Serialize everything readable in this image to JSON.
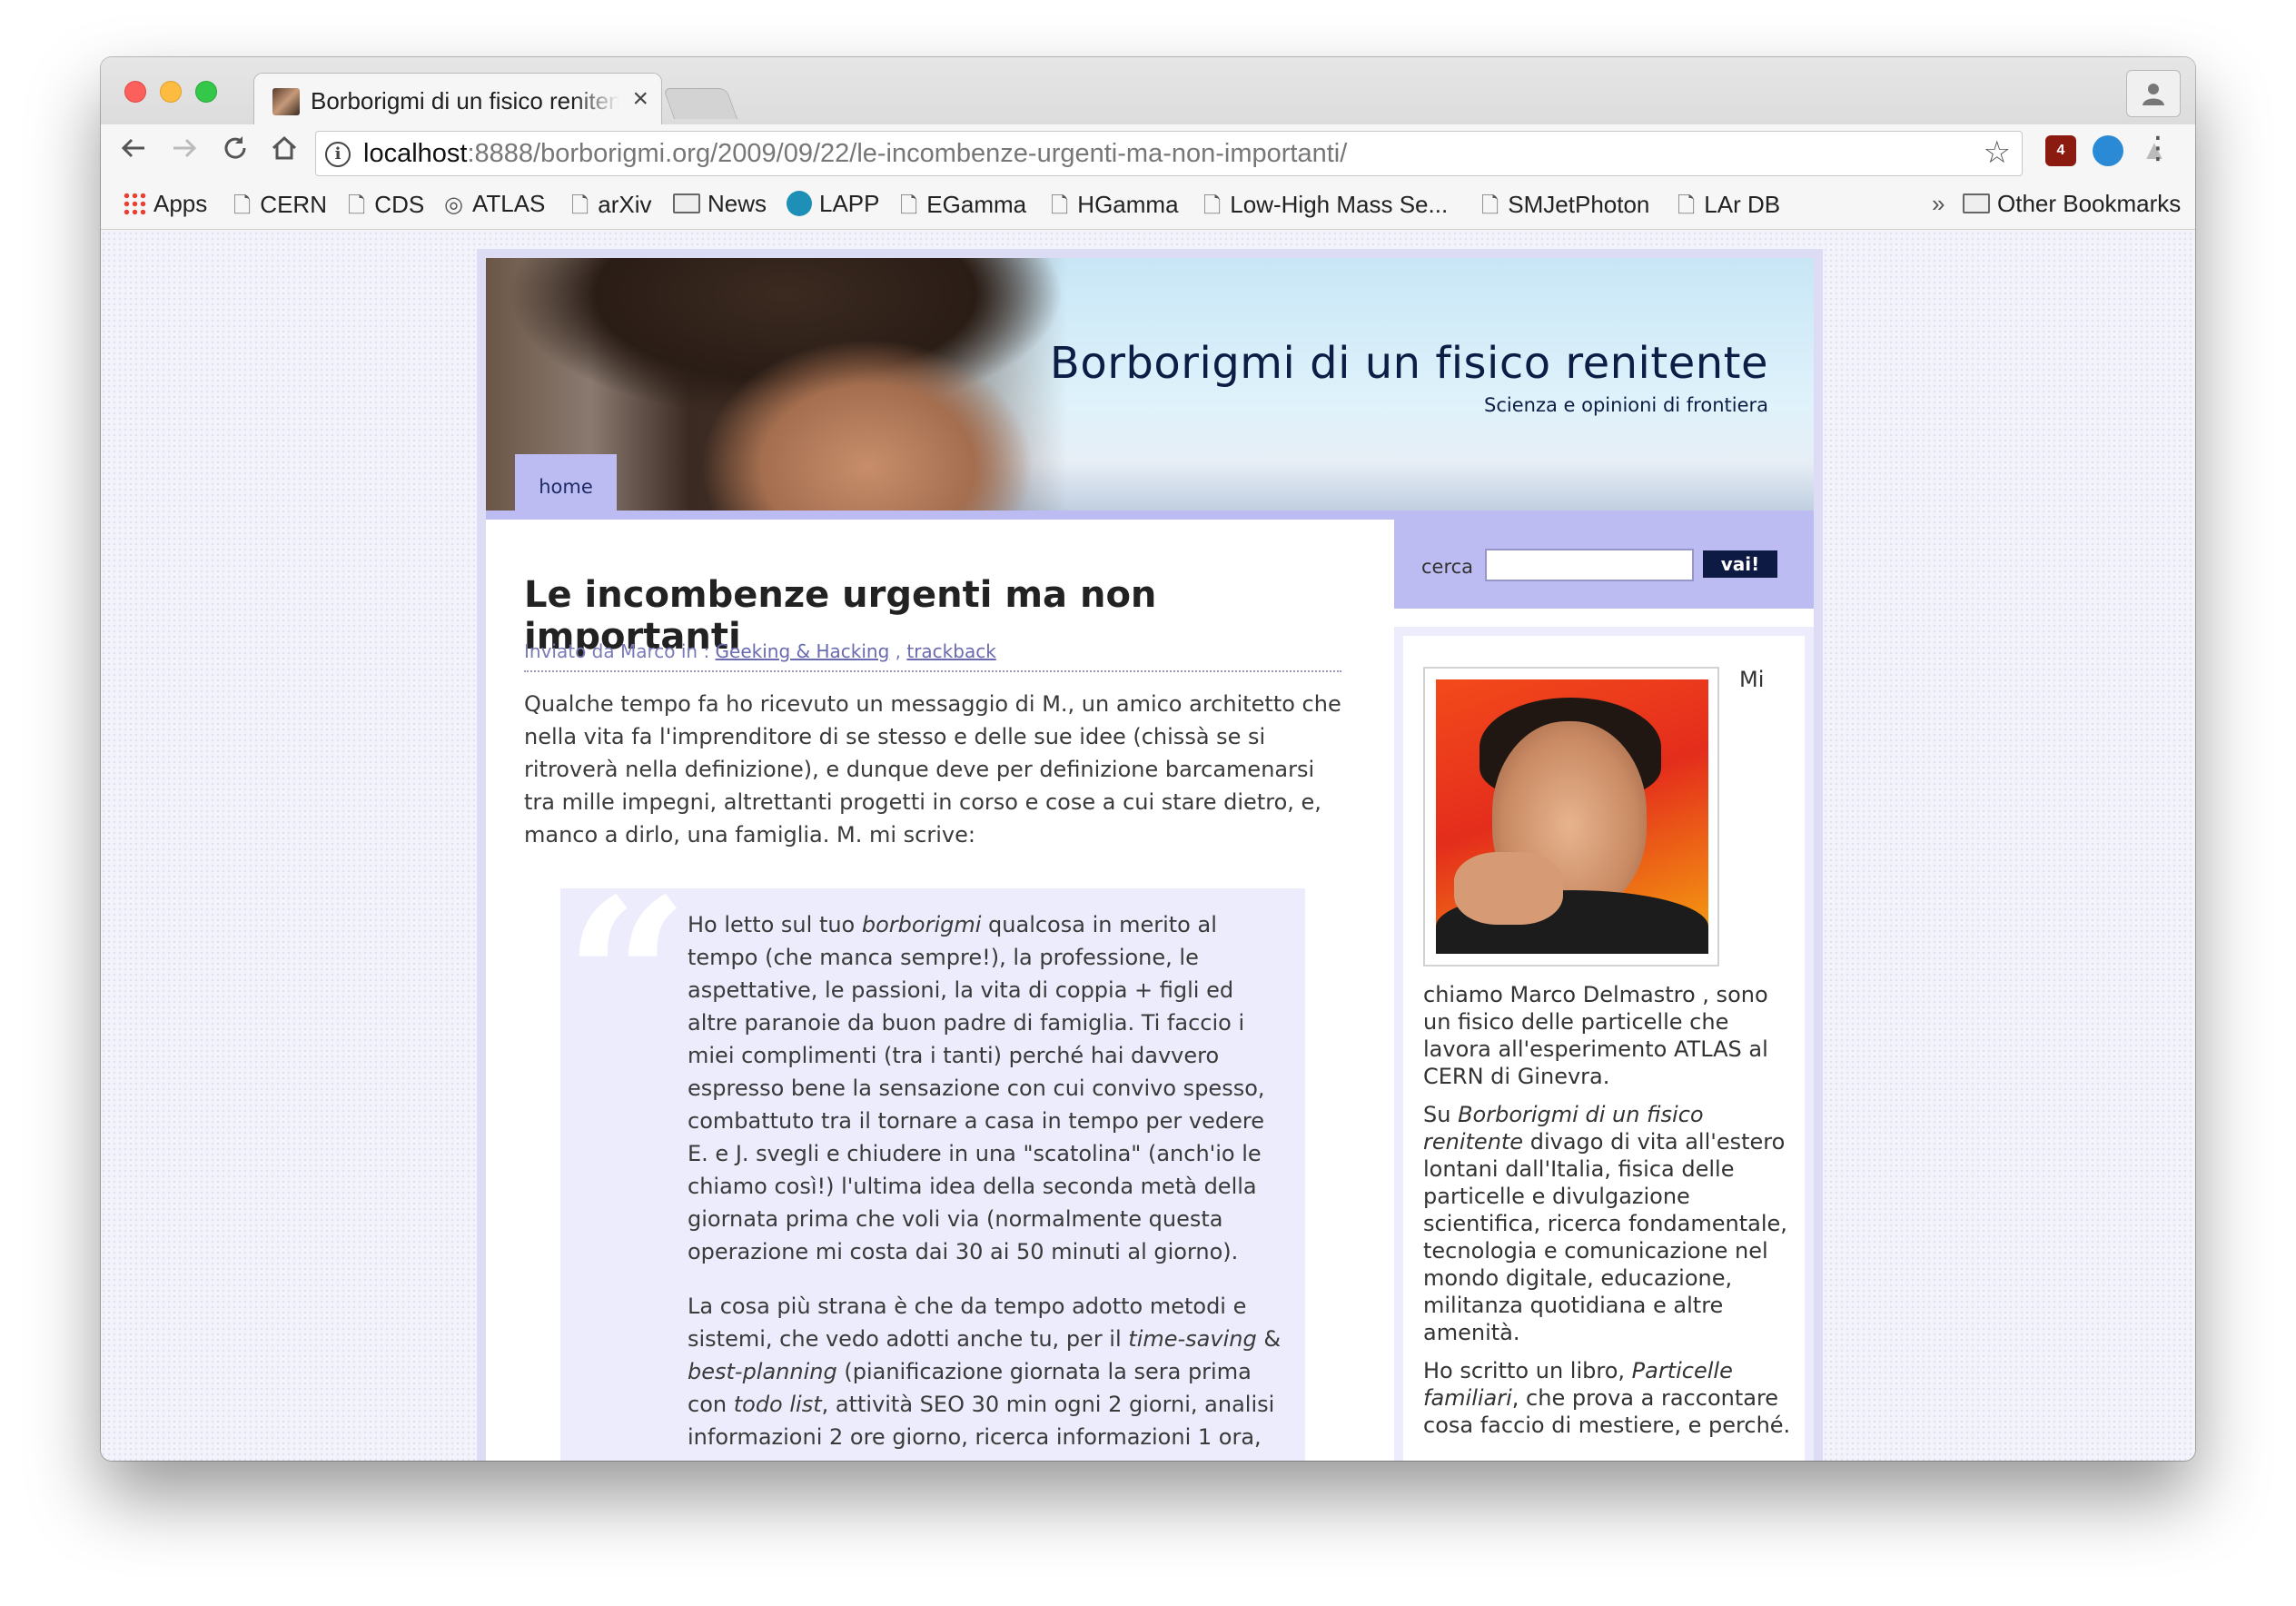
{
  "browser": {
    "tab_title": "Borborigmi di un fisico renitente",
    "tab_close": "×",
    "url_host": "localhost",
    "url_path": ":8888/borborigmi.org/2009/09/22/le-incombenze-urgenti-ma-non-importanti/",
    "extension_badge": "4",
    "icons": [
      "back-icon",
      "forward-icon",
      "reload-icon",
      "home-icon",
      "info-icon",
      "star-icon",
      "menu-icon"
    ]
  },
  "bookmarks": {
    "items": [
      "Apps",
      "CERN",
      "CDS",
      "ATLAS",
      "arXiv",
      "News",
      "LAPP",
      "EGamma",
      "HGamma",
      "Low-High Mass Se...",
      "SMJetPhoton",
      "LAr DB"
    ],
    "overflow": "»",
    "other": "Other Bookmarks"
  },
  "site": {
    "title": "Borborigmi di un fisico renitente",
    "subtitle": "Scienza e opinioni di frontiera",
    "nav_home": "home"
  },
  "post": {
    "title": "Le incombenze urgenti ma non importanti",
    "meta_prefix": "Inviato da Marco in : ",
    "category": "Geeking & Hacking",
    "separator": " , ",
    "trackback": "trackback",
    "intro": "Qualche tempo fa ho ricevuto un messaggio di M., un amico architetto che nella vita fa l'imprenditore di se stesso e delle sue idee (chissà se si ritroverà nella definizione), e dunque deve per definizione barcamenarsi tra mille impegni, altrettanti progetti in corso e cose a cui stare dietro, e, manco a dirlo, una famiglia. M. mi scrive:",
    "quote_p1_a": "Ho letto sul tuo ",
    "quote_p1_em": "borborigmi",
    "quote_p1_b": " qualcosa in merito al tempo (che manca sempre!), la professione, le aspettative, le passioni, la vita di coppia + figli ed altre paranoie da buon padre di famiglia. Ti faccio i miei complimenti (tra i tanti) perché hai davvero espresso bene la sensazione con cui convivo spesso, combattuto tra il tornare a casa in tempo per vedere E. e J. svegli e chiudere in una \"scatolina\" (anch'io le chiamo così!) l'ultima idea della seconda metà della giornata prima che voli via (normalmente questa operazione mi costa dai 30 ai 50 minuti al giorno).",
    "quote_p2_a": "La cosa più strana è che da tempo adotto metodi e sistemi, che vedo adotti anche tu, per il ",
    "quote_p2_em1": "time-saving",
    "quote_p2_b": " & ",
    "quote_p2_em2": "best-planning",
    "quote_p2_c": " (pianificazione giornata la sera prima con ",
    "quote_p2_em3": "todo list",
    "quote_p2_d": ", attività SEO 30 min ogni 2 giorni, analisi informazioni 2 ore giorno, ricerca informazioni 1 ora,"
  },
  "sidebar": {
    "search_label": "cerca",
    "search_value": "",
    "search_button": "vai!",
    "bio_mi": "Mi",
    "bio_p1": "chiamo  Marco Delmastro , sono un fisico delle particelle che lavora all'esperimento ATLAS al CERN di Ginevra.",
    "bio_p2_a": "Su ",
    "bio_p2_em": "Borborigmi di un fisico renitente",
    "bio_p2_b": " divago di vita all'estero lontani dall'Italia, fisica delle particelle e divulgazione scientifica, ricerca fondamentale, tecnologia e comunicazione nel mondo digitale, educazione, militanza quotidiana e altre amenità.",
    "bio_p3_a": "Ho  scritto un libro, ",
    "bio_p3_em": "Particelle familiari",
    "bio_p3_b": ",  che prova a raccontare cosa faccio di mestiere, e perché."
  }
}
